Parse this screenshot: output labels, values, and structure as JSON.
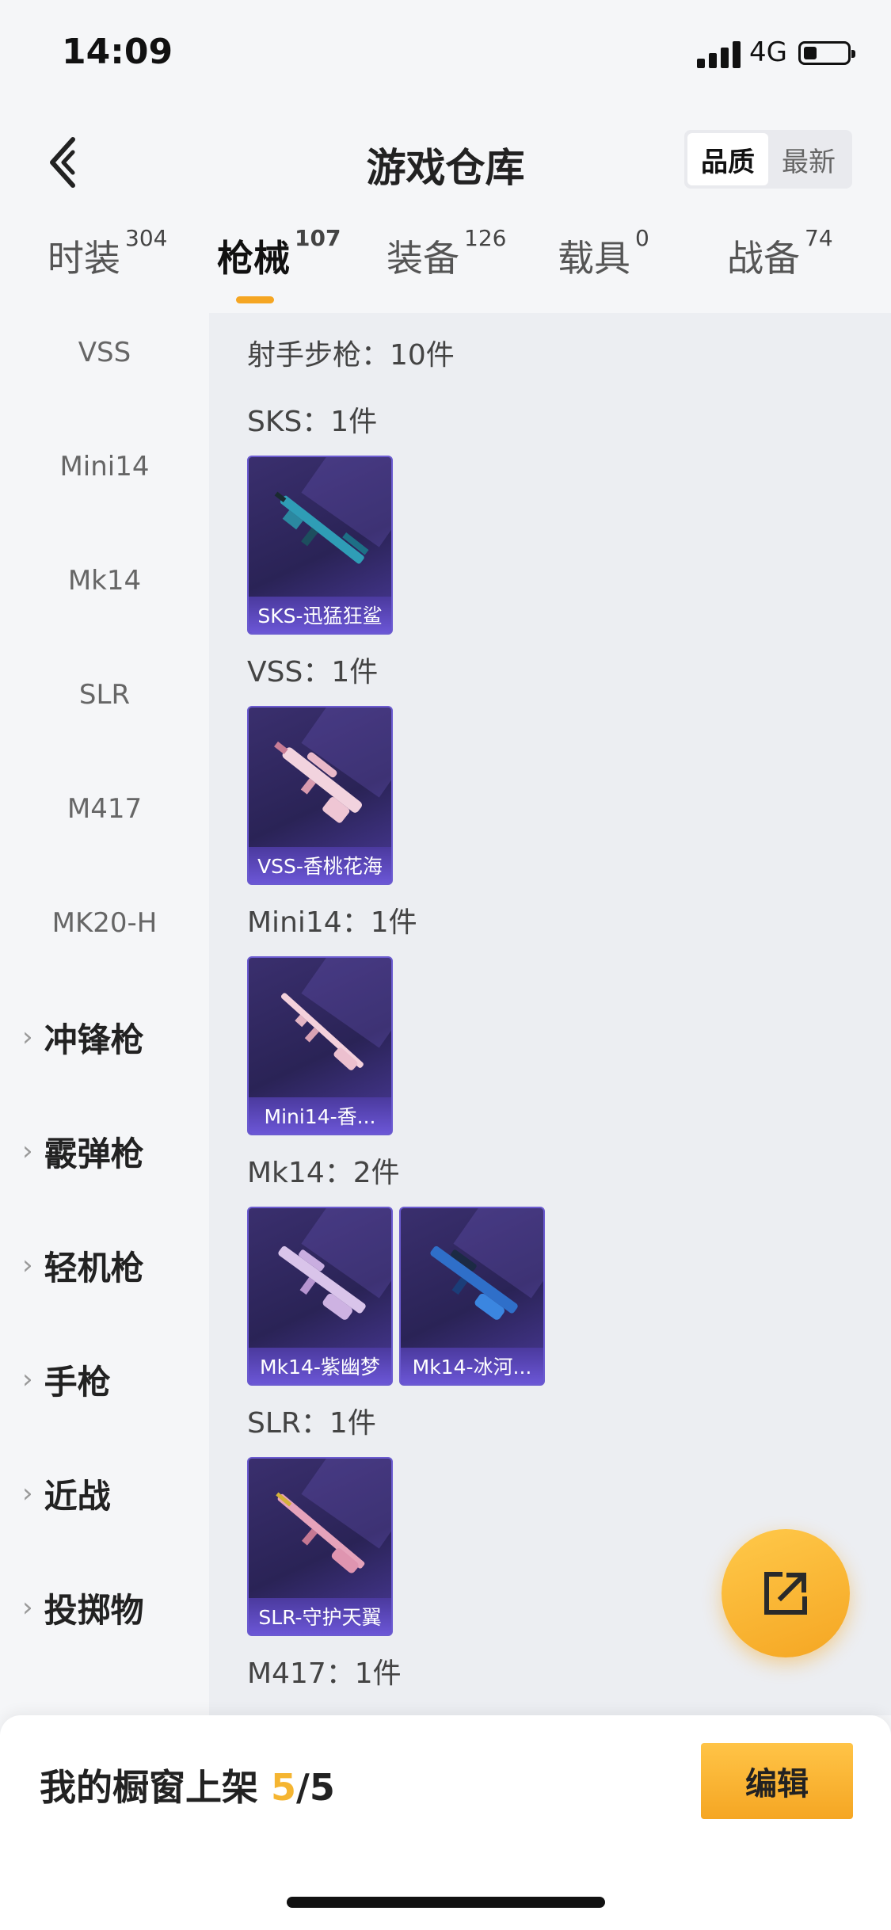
{
  "status_bar": {
    "time": "14:09",
    "network": "4G"
  },
  "header": {
    "title": "游戏仓库",
    "sort_options": [
      "品质",
      "最新"
    ],
    "sort_selected": "品质"
  },
  "tabs": [
    {
      "label": "时装",
      "count": "304"
    },
    {
      "label": "枪械",
      "count": "107"
    },
    {
      "label": "装备",
      "count": "126"
    },
    {
      "label": "载具",
      "count": "0"
    },
    {
      "label": "战备",
      "count": "74"
    }
  ],
  "active_tab": "枪械",
  "sidebar": {
    "sub_items": [
      "VSS",
      "Mini14",
      "Mk14",
      "SLR",
      "M417",
      "MK20-H"
    ],
    "categories": [
      "冲锋枪",
      "霰弹枪",
      "轻机枪",
      "手枪",
      "近战",
      "投掷物"
    ]
  },
  "content": {
    "summary": "射手步枪：10件",
    "groups": [
      {
        "label": "SKS：1件",
        "items": [
          "SKS-迅猛狂鲨"
        ]
      },
      {
        "label": "VSS：1件",
        "items": [
          "VSS-香桃花海"
        ]
      },
      {
        "label": "Mini14：1件",
        "items": [
          "Mini14-香..."
        ]
      },
      {
        "label": "Mk14：2件",
        "items": [
          "Mk14-紫幽梦",
          "Mk14-冰河..."
        ]
      },
      {
        "label": "SLR：1件",
        "items": [
          "SLR-守护天翼"
        ]
      },
      {
        "label": "M417：1件",
        "items": []
      }
    ]
  },
  "bottom": {
    "showcase_label": "我的橱窗上架",
    "current": "5",
    "total": "/5",
    "edit_label": "编辑"
  },
  "colors": {
    "accent": "#f5a623",
    "card_bg": "#2a2356",
    "card_caption": "#6b56d6"
  },
  "icons": [
    "back-chevron-icon",
    "share-external-icon",
    "chevron-right-icon",
    "signal-icon",
    "battery-icon"
  ]
}
